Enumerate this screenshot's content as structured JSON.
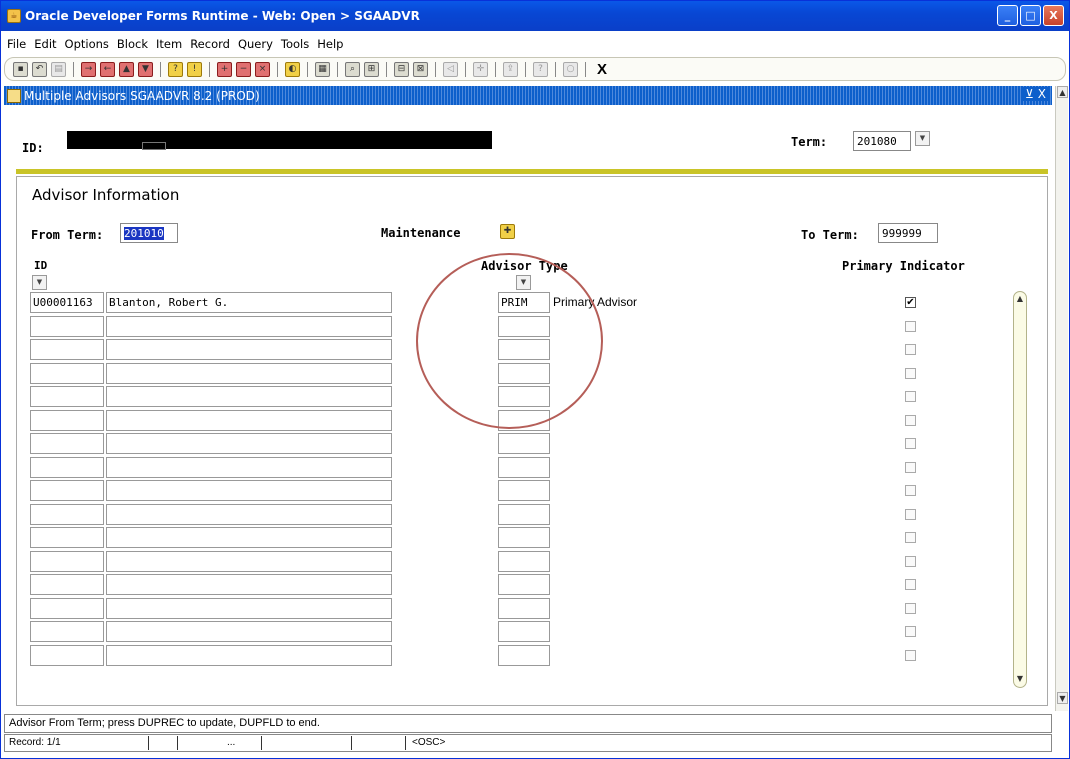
{
  "window": {
    "title": "Oracle Developer Forms Runtime - Web:  Open > SGAADVR",
    "buttons": {
      "minimize": "_",
      "maximize": "□",
      "close": "X"
    }
  },
  "menu": [
    "File",
    "Edit",
    "Options",
    "Block",
    "Item",
    "Record",
    "Query",
    "Tools",
    "Help"
  ],
  "toolbar": {
    "exit_label": "X"
  },
  "form": {
    "title": "Multiple Advisors  SGAADVR  8.2  (PROD)",
    "controls": "⊻ X"
  },
  "key": {
    "id_label": "ID:",
    "term_label": "Term:",
    "term_value": "201080"
  },
  "section": {
    "title": "Advisor Information",
    "from_term_label": "From Term:",
    "from_term_value": "201010",
    "maintenance_label": "Maintenance",
    "to_term_label": "To Term:",
    "to_term_value": "999999",
    "col_id": "ID",
    "col_advisor_type": "Advisor Type",
    "col_primary": "Primary Indicator"
  },
  "rows": [
    {
      "id": "U00001163",
      "name": "Blanton, Robert G.",
      "type": "PRIM",
      "type_desc": "Primary Advisor",
      "primary": true
    },
    {
      "id": "",
      "name": "",
      "type": "",
      "type_desc": "",
      "primary": false
    },
    {
      "id": "",
      "name": "",
      "type": "",
      "type_desc": "",
      "primary": false
    },
    {
      "id": "",
      "name": "",
      "type": "",
      "type_desc": "",
      "primary": false
    },
    {
      "id": "",
      "name": "",
      "type": "",
      "type_desc": "",
      "primary": false
    },
    {
      "id": "",
      "name": "",
      "type": "",
      "type_desc": "",
      "primary": false
    },
    {
      "id": "",
      "name": "",
      "type": "",
      "type_desc": "",
      "primary": false
    },
    {
      "id": "",
      "name": "",
      "type": "",
      "type_desc": "",
      "primary": false
    },
    {
      "id": "",
      "name": "",
      "type": "",
      "type_desc": "",
      "primary": false
    },
    {
      "id": "",
      "name": "",
      "type": "",
      "type_desc": "",
      "primary": false
    },
    {
      "id": "",
      "name": "",
      "type": "",
      "type_desc": "",
      "primary": false
    },
    {
      "id": "",
      "name": "",
      "type": "",
      "type_desc": "",
      "primary": false
    },
    {
      "id": "",
      "name": "",
      "type": "",
      "type_desc": "",
      "primary": false
    },
    {
      "id": "",
      "name": "",
      "type": "",
      "type_desc": "",
      "primary": false
    },
    {
      "id": "",
      "name": "",
      "type": "",
      "type_desc": "",
      "primary": false
    },
    {
      "id": "",
      "name": "",
      "type": "",
      "type_desc": "",
      "primary": false
    }
  ],
  "status": {
    "message": "Advisor From Term; press DUPREC to update, DUPFLD to end.",
    "record": "Record: 1/1",
    "ellipsis": "...",
    "osc": "<OSC>"
  },
  "colors": {
    "titlebar": "#0a58e8",
    "accent_bar": "#c9c428",
    "annotation_circle": "#b55e58",
    "selection": "#1a36c2"
  }
}
